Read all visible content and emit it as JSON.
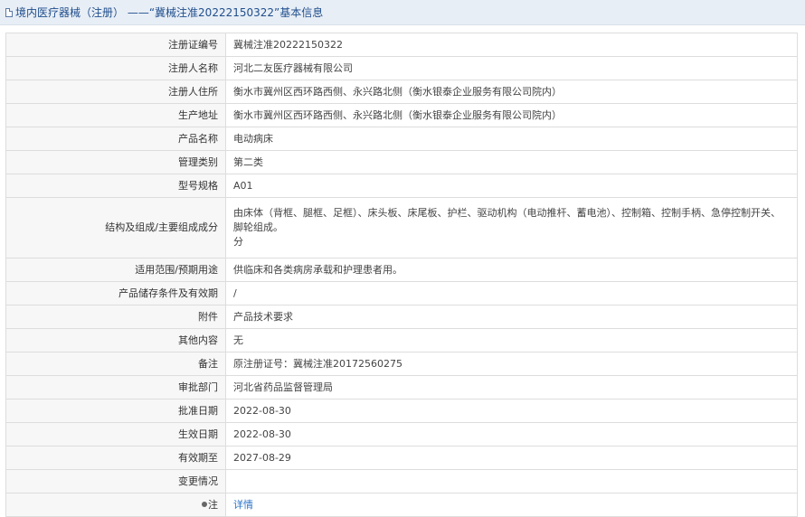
{
  "header": {
    "prefix": "境内医疗器械（注册） —— ",
    "highlight": "“冀械注准20222150322”",
    "suffix": " 基本信息"
  },
  "rows": [
    {
      "label": "注册证编号",
      "value": "冀械注准20222150322"
    },
    {
      "label": "注册人名称",
      "value": "河北二友医疗器械有限公司"
    },
    {
      "label": "注册人住所",
      "value": "衡水市冀州区西环路西侧、永兴路北侧（衡水银泰企业服务有限公司院内）"
    },
    {
      "label": "生产地址",
      "value": "衡水市冀州区西环路西侧、永兴路北侧（衡水银泰企业服务有限公司院内）"
    },
    {
      "label": "产品名称",
      "value": "电动病床"
    },
    {
      "label": "管理类别",
      "value": "第二类"
    },
    {
      "label": "型号规格",
      "value": "A01"
    },
    {
      "label": "结构及组成/主要组成成分",
      "value_line1": "由床体（背框、腿框、足框）、床头板、床尾板、护栏、驱动机构（电动推杆、蓄电池）、控制箱、控制手柄、急停控制开关、脚轮组成。",
      "value_line2": "分"
    },
    {
      "label": "适用范围/预期用途",
      "value": "供临床和各类病房承载和护理患者用。"
    },
    {
      "label": "产品储存条件及有效期",
      "value": "/"
    },
    {
      "label": "附件",
      "value": "产品技术要求"
    },
    {
      "label": "其他内容",
      "value": "无"
    },
    {
      "label": "备注",
      "value": "原注册证号：冀械注准20172560275"
    },
    {
      "label": "审批部门",
      "value": "河北省药品监督管理局"
    },
    {
      "label": "批准日期",
      "value": "2022-08-30"
    },
    {
      "label": "生效日期",
      "value": "2022-08-30"
    },
    {
      "label": "有效期至",
      "value": "2027-08-29"
    },
    {
      "label": "变更情况",
      "value": ""
    },
    {
      "label": "注",
      "value": "详情"
    }
  ],
  "colors": {
    "header_bg": "#e8eef6",
    "header_text": "#1f4e8c",
    "label_bg": "#f7f7f7",
    "link": "#2b73c9",
    "border": "#dddddd"
  },
  "icons": [
    "document-icon",
    "pin-icon"
  ]
}
